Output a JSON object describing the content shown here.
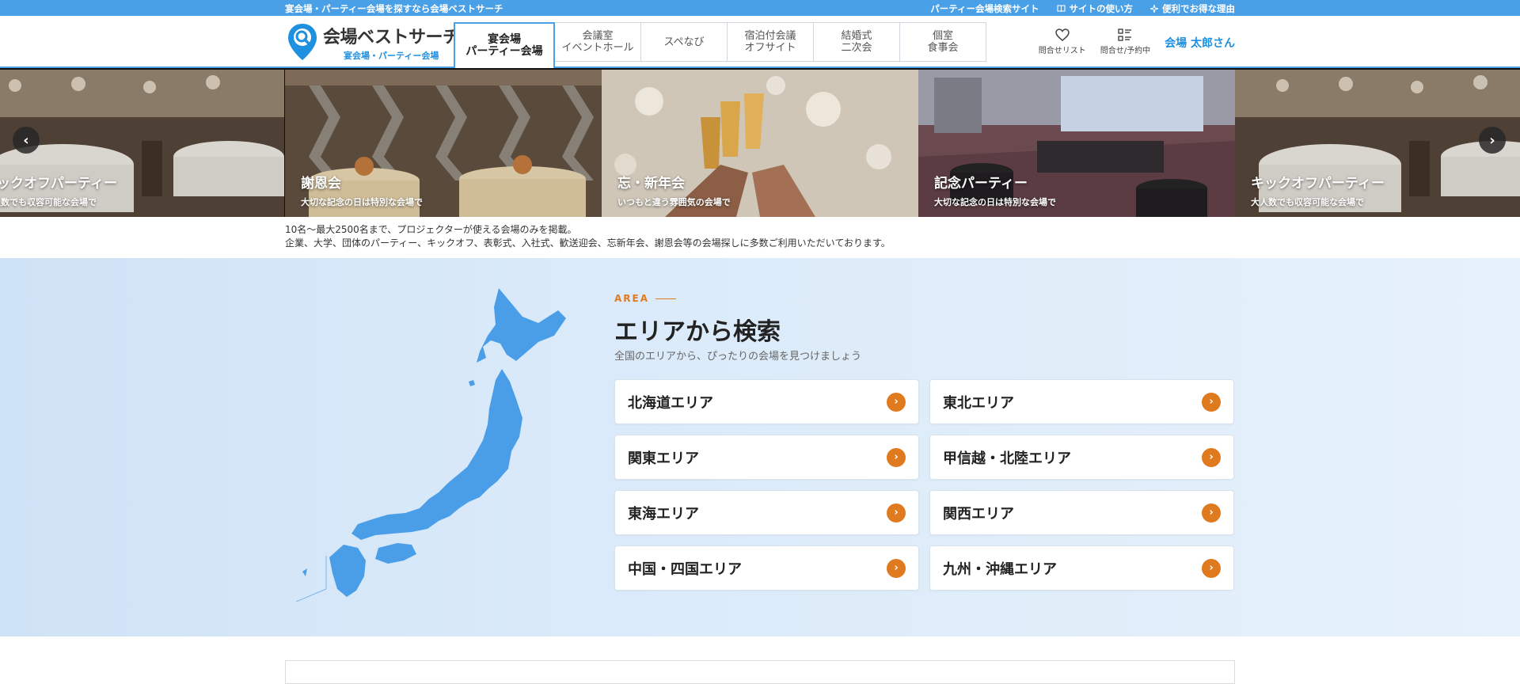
{
  "topbar": {
    "tagline": "宴会場・パーティー会場を探すなら会場ベストサーチ",
    "links": [
      "パーティー会場検索サイト",
      "サイトの使い方",
      "便利でお得な理由"
    ]
  },
  "logo": {
    "name": "会場ベストサーチ",
    "subtitle": "宴会場・パーティー会場"
  },
  "nav": [
    {
      "line1": "宴会場",
      "line2": "パーティー会場",
      "active": true
    },
    {
      "line1": "会議室",
      "line2": "イベントホール",
      "active": false
    },
    {
      "line1": "スペなび",
      "line2": "",
      "active": false
    },
    {
      "line1": "宿泊付会議",
      "line2": "オフサイト",
      "active": false
    },
    {
      "line1": "結婚式",
      "line2": "二次会",
      "active": false
    },
    {
      "line1": "個室",
      "line2": "食事会",
      "active": false
    }
  ],
  "header_right": {
    "favorites_label": "問合せリスト",
    "inquiry_label": "問合せ/予約中",
    "user_name": "会場 太郎さん"
  },
  "slides": [
    {
      "title": "キックオフパーティー",
      "subtitle": "大人数でも収容可能な会場で"
    },
    {
      "title": "謝恩会",
      "subtitle": "大切な記念の日は特別な会場で"
    },
    {
      "title": "忘・新年会",
      "subtitle": "いつもと違う雰囲気の会場で"
    },
    {
      "title": "記念パーティー",
      "subtitle": "大切な記念の日は特別な会場で"
    },
    {
      "title": "キックオフパーティー",
      "subtitle": "大人数でも収容可能な会場で"
    }
  ],
  "intro": {
    "line1": "10名〜最大2500名まで、プロジェクターが使える会場のみを掲載。",
    "line2": "企業、大学、団体のパーティー、キックオフ、表彰式、入社式、歓送迎会、忘新年会、謝恩会等の会場探しに多数ご利用いただいております。"
  },
  "area": {
    "label": "AREA",
    "title": "エリアから検索",
    "description": "全国のエリアから、ぴったりの会場を見つけましょう",
    "regions": [
      "北海道エリア",
      "東北エリア",
      "関東エリア",
      "甲信越・北陸エリア",
      "東海エリア",
      "関西エリア",
      "中国・四国エリア",
      "九州・沖縄エリア"
    ]
  },
  "colors": {
    "brand_blue": "#4aa0e6",
    "accent_orange": "#e07a1f",
    "map_blue": "#4a9ee8"
  }
}
